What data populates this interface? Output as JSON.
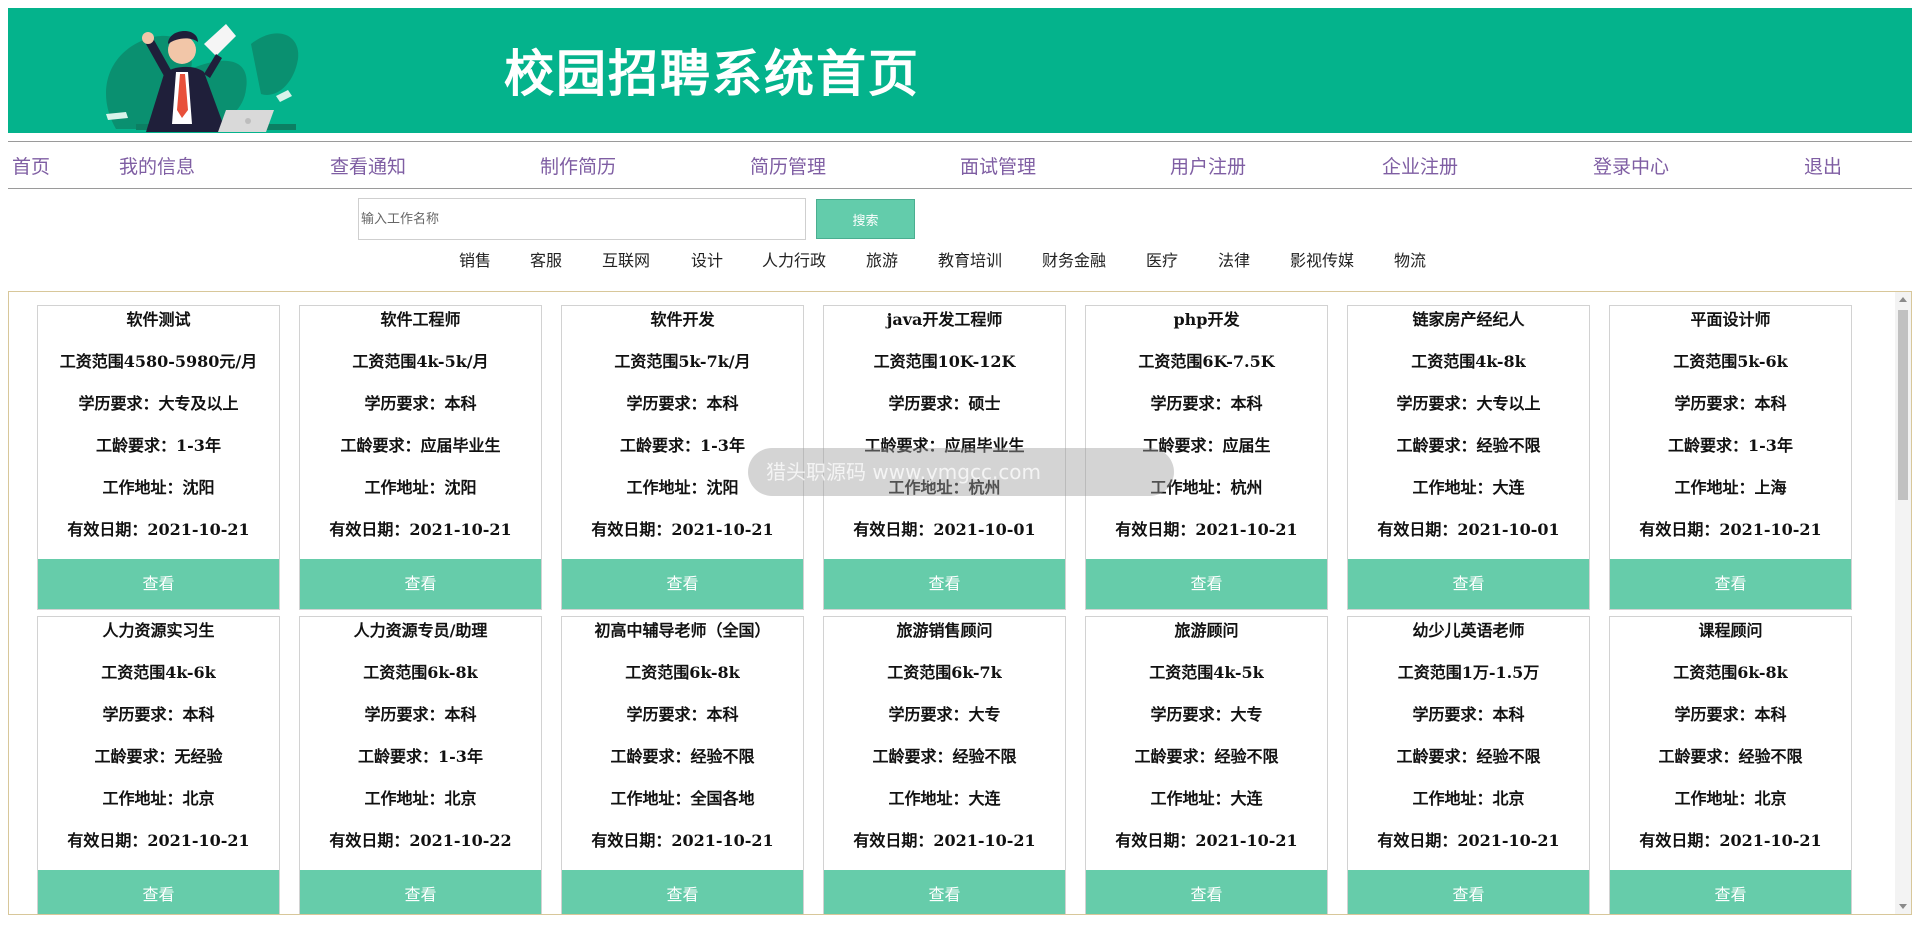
{
  "header": {
    "title": "校园招聘系统首页"
  },
  "nav": {
    "items": [
      "首页",
      "我的信息",
      "查看通知",
      "制作简历",
      "简历管理",
      "面试管理",
      "用户注册",
      "企业注册",
      "登录中心",
      "退出"
    ]
  },
  "search": {
    "placeholder": "输入工作名称",
    "button_label": "搜索"
  },
  "categories": [
    "销售",
    "客服",
    "互联网",
    "设计",
    "人力行政",
    "旅游",
    "教育培训",
    "财务金融",
    "医疗",
    "法律",
    "影视传媒",
    "物流"
  ],
  "jobs": [
    {
      "title": "软件测试",
      "salary": "工资范围4580-5980元/月",
      "education": "学历要求：大专及以上",
      "experience": "工龄要求：1-3年",
      "location": "工作地址：沈阳",
      "valid": "有效日期：2021-10-21",
      "button": "查看"
    },
    {
      "title": "软件工程师",
      "salary": "工资范围4k-5k/月",
      "education": "学历要求：本科",
      "experience": "工龄要求：应届毕业生",
      "location": "工作地址：沈阳",
      "valid": "有效日期：2021-10-21",
      "button": "查看"
    },
    {
      "title": "软件开发",
      "salary": "工资范围5k-7k/月",
      "education": "学历要求：本科",
      "experience": "工龄要求：1-3年",
      "location": "工作地址：沈阳",
      "valid": "有效日期：2021-10-21",
      "button": "查看"
    },
    {
      "title": "java开发工程师",
      "salary": "工资范围10K-12K",
      "education": "学历要求：硕士",
      "experience": "工龄要求：应届毕业生",
      "location": "工作地址：杭州",
      "valid": "有效日期：2021-10-01",
      "button": "查看"
    },
    {
      "title": "php开发",
      "salary": "工资范围6K-7.5K",
      "education": "学历要求：本科",
      "experience": "工龄要求：应届生",
      "location": "工作地址：杭州",
      "valid": "有效日期：2021-10-21",
      "button": "查看"
    },
    {
      "title": "链家房产经纪人",
      "salary": "工资范围4k-8k",
      "education": "学历要求：大专以上",
      "experience": "工龄要求：经验不限",
      "location": "工作地址：大连",
      "valid": "有效日期：2021-10-01",
      "button": "查看"
    },
    {
      "title": "平面设计师",
      "salary": "工资范围5k-6k",
      "education": "学历要求：本科",
      "experience": "工龄要求：1-3年",
      "location": "工作地址：上海",
      "valid": "有效日期：2021-10-21",
      "button": "查看"
    },
    {
      "title": "人力资源实习生",
      "salary": "工资范围4k-6k",
      "education": "学历要求：本科",
      "experience": "工龄要求：无经验",
      "location": "工作地址：北京",
      "valid": "有效日期：2021-10-21",
      "button": "查看"
    },
    {
      "title": "人力资源专员/助理",
      "salary": "工资范围6k-8k",
      "education": "学历要求：本科",
      "experience": "工龄要求：1-3年",
      "location": "工作地址：北京",
      "valid": "有效日期：2021-10-22",
      "button": "查看"
    },
    {
      "title": "初高中辅导老师（全国）",
      "salary": "工资范围6k-8k",
      "education": "学历要求：本科",
      "experience": "工龄要求：经验不限",
      "location": "工作地址：全国各地",
      "valid": "有效日期：2021-10-21",
      "button": "查看"
    },
    {
      "title": "旅游销售顾问",
      "salary": "工资范围6k-7k",
      "education": "学历要求：大专",
      "experience": "工龄要求：经验不限",
      "location": "工作地址：大连",
      "valid": "有效日期：2021-10-21",
      "button": "查看"
    },
    {
      "title": "旅游顾问",
      "salary": "工资范围4k-5k",
      "education": "学历要求：大专",
      "experience": "工龄要求：经验不限",
      "location": "工作地址：大连",
      "valid": "有效日期：2021-10-21",
      "button": "查看"
    },
    {
      "title": "幼少儿英语老师",
      "salary": "工资范围1万-1.5万",
      "education": "学历要求：本科",
      "experience": "工龄要求：经验不限",
      "location": "工作地址：北京",
      "valid": "有效日期：2021-10-21",
      "button": "查看"
    },
    {
      "title": "课程顾问",
      "salary": "工资范围6k-8k",
      "education": "学历要求：本科",
      "experience": "工龄要求：经验不限",
      "location": "工作地址：北京",
      "valid": "有效日期：2021-10-21",
      "button": "查看"
    }
  ],
  "watermark": "猎头职源码 www.ymgcc.com",
  "colors": {
    "header_bg": "#04b38c",
    "button_bg": "#66ccaa",
    "nav_text": "#7f5ea3"
  }
}
